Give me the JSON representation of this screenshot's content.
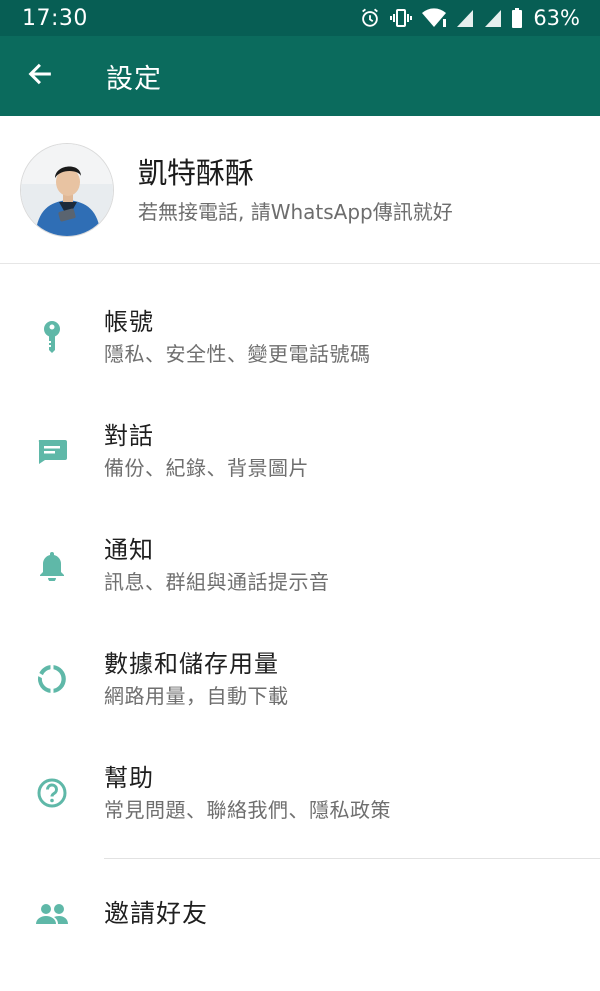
{
  "status_bar": {
    "time": "17:30",
    "battery": "63%",
    "icons": [
      "alarm-icon",
      "vibrate-icon",
      "wifi-icon",
      "signal-icon",
      "signal-icon",
      "battery-icon"
    ]
  },
  "app_bar": {
    "title": "設定",
    "back_icon": "arrow-left-icon"
  },
  "profile": {
    "name": "凱特酥酥",
    "status": "若無接電話, 請WhatsApp傳訊就好"
  },
  "menu": [
    {
      "icon": "key-icon",
      "title": "帳號",
      "subtitle": "隱私、安全性、變更電話號碼"
    },
    {
      "icon": "chat-icon",
      "title": "對話",
      "subtitle": "備份、紀錄、背景圖片"
    },
    {
      "icon": "bell-icon",
      "title": "通知",
      "subtitle": "訊息、群組與通話提示音"
    },
    {
      "icon": "data-usage-icon",
      "title": "數據和儲存用量",
      "subtitle": "網路用量，自動下載"
    },
    {
      "icon": "help-icon",
      "title": "幫助",
      "subtitle": "常見問題、聯絡我們、隱私政策"
    }
  ],
  "invite": {
    "icon": "people-icon",
    "label": "邀請好友"
  },
  "colors": {
    "status_bar": "#075e54",
    "app_bar": "#0b6b5d",
    "icon_teal": "#5fb8a8"
  }
}
